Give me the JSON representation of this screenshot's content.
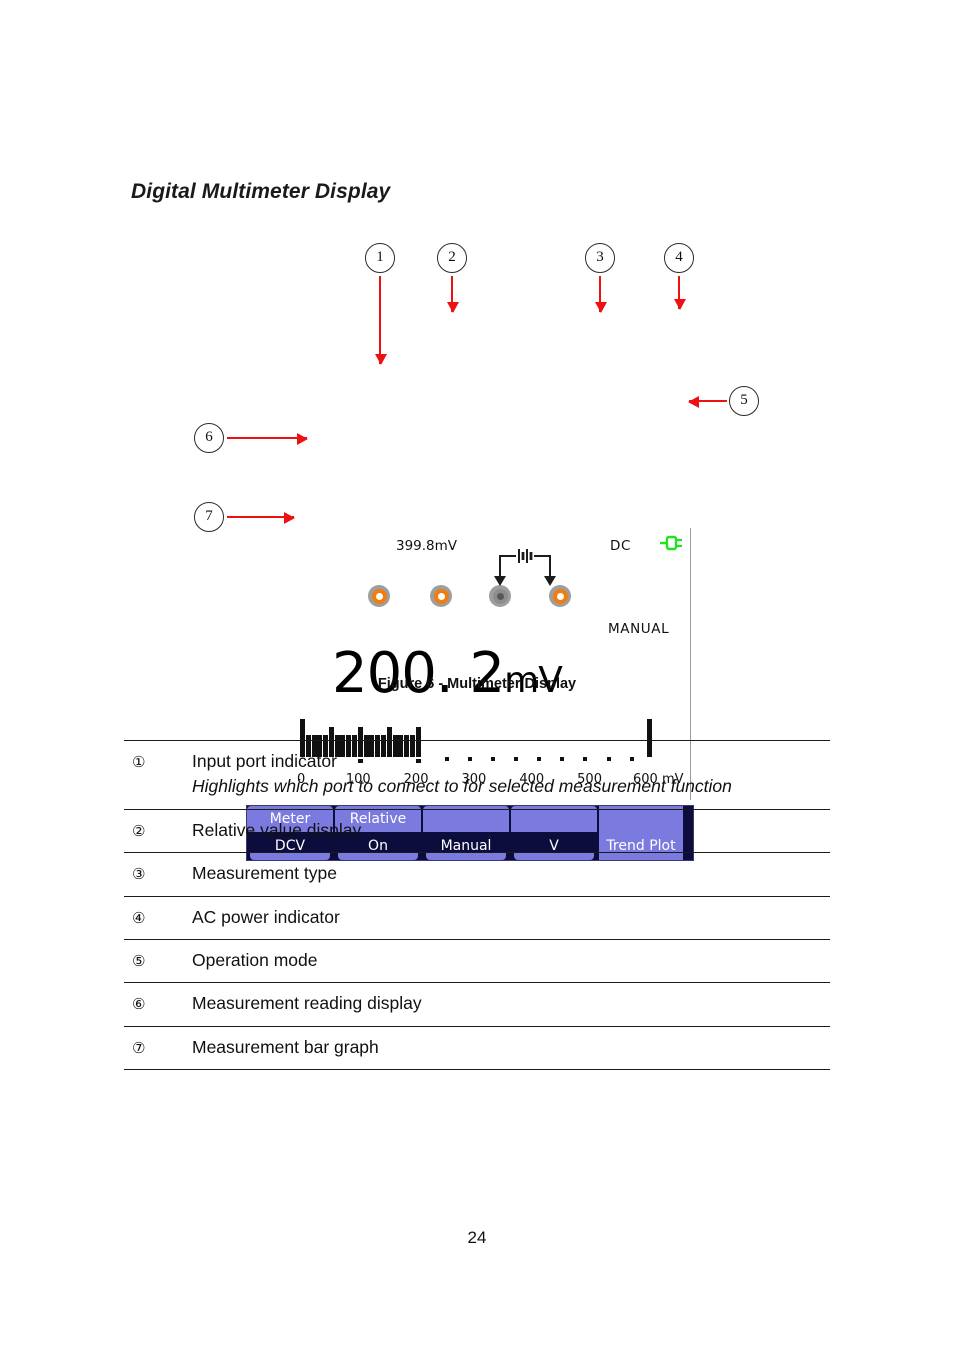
{
  "document": {
    "section_title": "Digital Multimeter Display",
    "figure_caption": "Figure 6 - Multimeter Display",
    "page_number": "24"
  },
  "figure": {
    "callouts": [
      {
        "id": "1",
        "label": "1"
      },
      {
        "id": "2",
        "label": "2"
      },
      {
        "id": "3",
        "label": "3"
      },
      {
        "id": "4",
        "label": "4"
      },
      {
        "id": "5",
        "label": "5"
      },
      {
        "id": "6",
        "label": "6"
      },
      {
        "id": "7",
        "label": "7"
      }
    ],
    "lcd": {
      "relative_value": "399.8mV",
      "measurement_type": "DC",
      "operation_mode": "MANUAL",
      "reading_value": "200. 2",
      "reading_unit": "mV",
      "ac_power_icon": "power-plug-icon",
      "ac_power_color": "#22e022",
      "port_active_color": "#f07d10",
      "port_inactive_color": "#8d8d8d",
      "ports": [
        {
          "name": "port-1",
          "state": "active"
        },
        {
          "name": "port-2",
          "state": "active"
        },
        {
          "name": "port-3",
          "state": "inactive"
        },
        {
          "name": "port-4",
          "state": "active"
        }
      ],
      "softkeys": [
        {
          "top": "Meter",
          "bottom": "DCV",
          "style": "split"
        },
        {
          "top": "Relative",
          "bottom": "On",
          "style": "split"
        },
        {
          "top": "",
          "bottom": "Manual",
          "style": "split"
        },
        {
          "top": "",
          "bottom": "V",
          "style": "split"
        },
        {
          "top": "",
          "bottom": "Trend Plot",
          "style": "solid"
        }
      ],
      "softkey_top_color": "#7b7bdf",
      "softkey_bottom_color": "#0d0d3d"
    },
    "chart_data": {
      "type": "bar",
      "title": "Measurement bar graph",
      "xlabel": "mV",
      "ylabel": "",
      "xlim": [
        0,
        600
      ],
      "unit_label": "600 mV",
      "tick_labels": [
        "0",
        "100",
        "200",
        "300",
        "400",
        "500",
        "600"
      ],
      "tick_values": [
        0,
        100,
        200,
        300,
        400,
        500,
        600
      ],
      "value": 200.2,
      "full_scale": 600,
      "grid": false,
      "legend": "none",
      "segment_step": 10,
      "filled_segments": 20,
      "empty_dot_values": [
        250,
        290,
        330,
        370,
        410,
        450,
        490,
        530,
        570
      ],
      "description": "Filled bar segments from 0 to 200 mV indicating a reading of 200.2 mV on a 0-600 mV scale"
    }
  },
  "legend_table": {
    "rows": [
      {
        "num": "①",
        "text": "Input port indicator",
        "subtext": "Highlights which port to connect to for selected measurement function"
      },
      {
        "num": "②",
        "text": "Relative value display",
        "subtext": ""
      },
      {
        "num": "③",
        "text": "Measurement type",
        "subtext": ""
      },
      {
        "num": "④",
        "text": "AC power indicator",
        "subtext": ""
      },
      {
        "num": "⑤",
        "text": "Operation mode",
        "subtext": ""
      },
      {
        "num": "⑥",
        "text": "Measurement reading display",
        "subtext": ""
      },
      {
        "num": "⑦",
        "text": "Measurement bar graph",
        "subtext": ""
      }
    ]
  }
}
